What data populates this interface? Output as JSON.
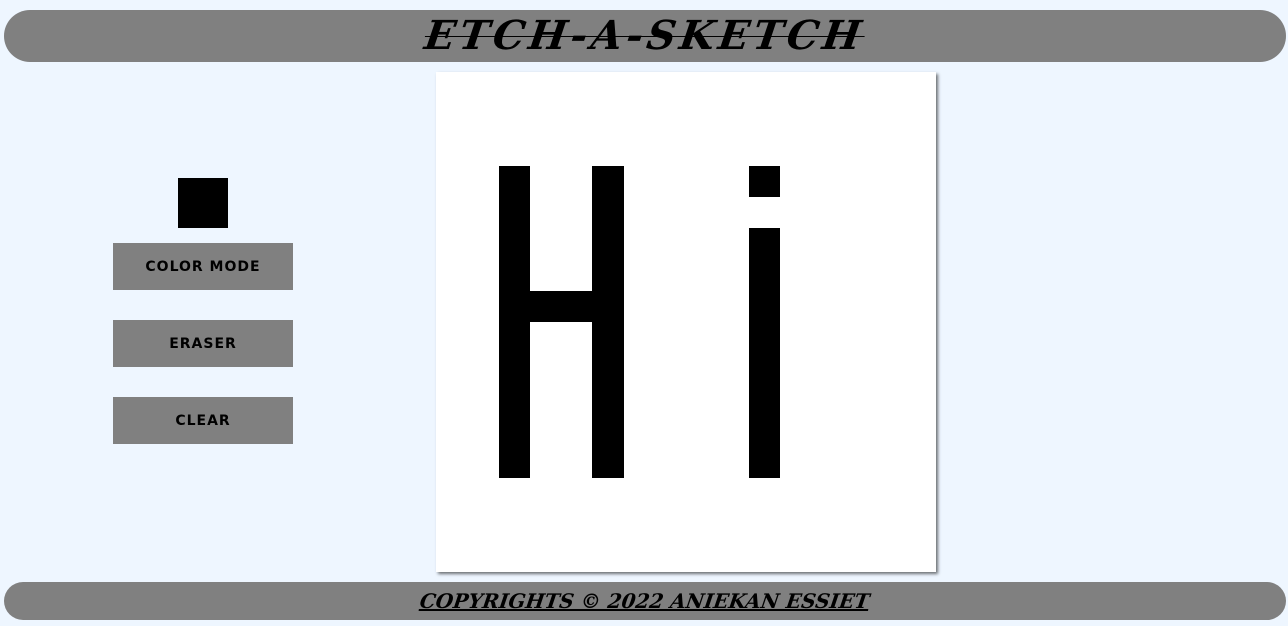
{
  "header": {
    "title": "ETCH-A-SKETCH"
  },
  "controls": {
    "current_color": "#000000",
    "color_mode_label": "COLOR MODE",
    "eraser_label": "ERASER",
    "clear_label": "CLEAR"
  },
  "board": {
    "background": "#ffffff",
    "ink": "#000000"
  },
  "footer": {
    "copyright": "COPYRIGHTS © 2022 ANIEKAN ESSIET"
  },
  "colors": {
    "page_background": "#eef6ff",
    "bar_gray": "#808080"
  }
}
